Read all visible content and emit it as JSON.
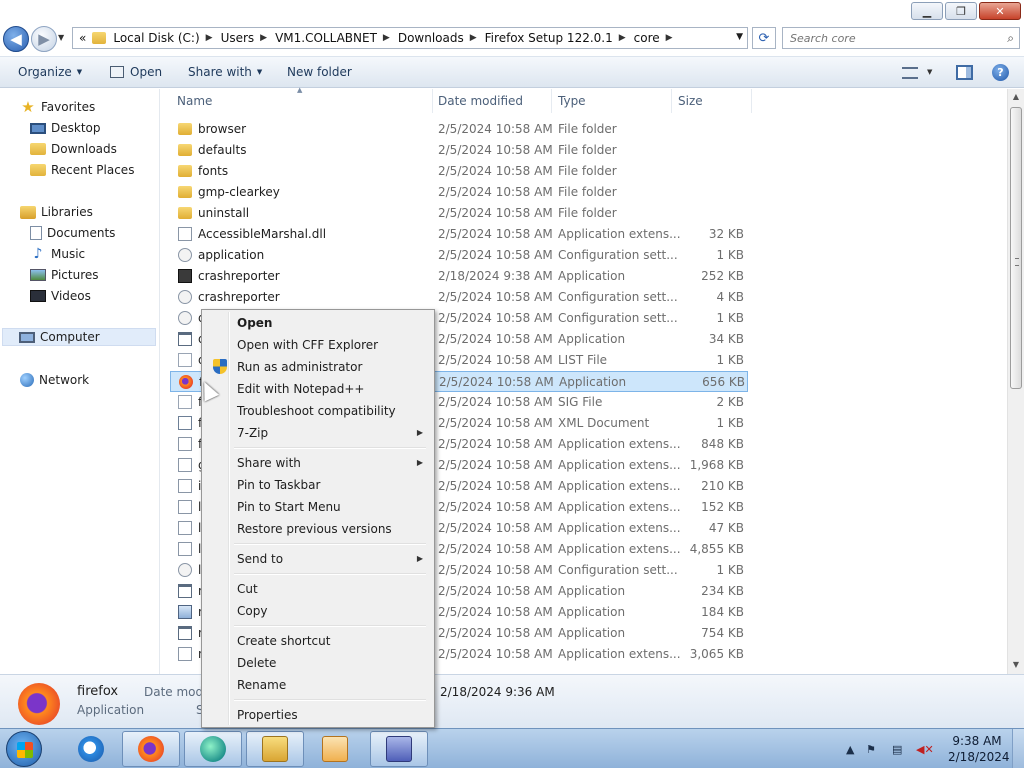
{
  "window": {
    "minimize_label": "▁",
    "maximize_label": "❐",
    "close_label": "✕"
  },
  "address": {
    "prefix": "«",
    "breadcrumbs": [
      "Local Disk (C:)",
      "Users",
      "VM1.COLLABNET",
      "Downloads",
      "Firefox Setup 122.0.1",
      "core"
    ],
    "separator": "▶",
    "search_placeholder": "Search core"
  },
  "toolbar": {
    "organize": "Organize",
    "open": "Open",
    "share_with": "Share with",
    "new_folder": "New folder"
  },
  "nav": {
    "favorites": "Favorites",
    "desktop": "Desktop",
    "downloads": "Downloads",
    "recent_places": "Recent Places",
    "libraries": "Libraries",
    "documents": "Documents",
    "music": "Music",
    "pictures": "Pictures",
    "videos": "Videos",
    "computer": "Computer",
    "network": "Network"
  },
  "columns": {
    "name": "Name",
    "date_modified": "Date modified",
    "type": "Type",
    "size": "Size"
  },
  "files": [
    {
      "name": "browser",
      "date": "2/5/2024 10:58 AM",
      "type": "File folder",
      "size": "",
      "icon": "folder"
    },
    {
      "name": "defaults",
      "date": "2/5/2024 10:58 AM",
      "type": "File folder",
      "size": "",
      "icon": "folder"
    },
    {
      "name": "fonts",
      "date": "2/5/2024 10:58 AM",
      "type": "File folder",
      "size": "",
      "icon": "folder"
    },
    {
      "name": "gmp-clearkey",
      "date": "2/5/2024 10:58 AM",
      "type": "File folder",
      "size": "",
      "icon": "folder"
    },
    {
      "name": "uninstall",
      "date": "2/5/2024 10:58 AM",
      "type": "File folder",
      "size": "",
      "icon": "folder"
    },
    {
      "name": "AccessibleMarshal.dll",
      "date": "2/5/2024 10:58 AM",
      "type": "Application extens...",
      "size": "32 KB",
      "icon": "dll"
    },
    {
      "name": "application",
      "date": "2/5/2024 10:58 AM",
      "type": "Configuration sett...",
      "size": "1 KB",
      "icon": "config"
    },
    {
      "name": "crashreporter",
      "date": "2/18/2024 9:38 AM",
      "type": "Application",
      "size": "252 KB",
      "icon": "crash"
    },
    {
      "name": "crashreporter",
      "date": "2/5/2024 10:58 AM",
      "type": "Configuration sett...",
      "size": "4 KB",
      "icon": "config"
    },
    {
      "name": "d",
      "date": "2/5/2024 10:58 AM",
      "type": "Configuration sett...",
      "size": "1 KB",
      "icon": "config"
    },
    {
      "name": "d",
      "date": "2/5/2024 10:58 AM",
      "type": "Application",
      "size": "34 KB",
      "icon": "app"
    },
    {
      "name": "d",
      "date": "2/5/2024 10:58 AM",
      "type": "LIST File",
      "size": "1 KB",
      "icon": "file"
    },
    {
      "name": "f",
      "date": "2/5/2024 10:58 AM",
      "type": "Application",
      "size": "656 KB",
      "icon": "ff"
    },
    {
      "name": "f",
      "date": "2/5/2024 10:58 AM",
      "type": "SIG File",
      "size": "2 KB",
      "icon": "file"
    },
    {
      "name": "f",
      "date": "2/5/2024 10:58 AM",
      "type": "XML Document",
      "size": "1 KB",
      "icon": "xml"
    },
    {
      "name": "f",
      "date": "2/5/2024 10:58 AM",
      "type": "Application extens...",
      "size": "848 KB",
      "icon": "dll"
    },
    {
      "name": "g",
      "date": "2/5/2024 10:58 AM",
      "type": "Application extens...",
      "size": "1,968 KB",
      "icon": "dll"
    },
    {
      "name": "i",
      "date": "2/5/2024 10:58 AM",
      "type": "Application extens...",
      "size": "210 KB",
      "icon": "dll"
    },
    {
      "name": "l",
      "date": "2/5/2024 10:58 AM",
      "type": "Application extens...",
      "size": "152 KB",
      "icon": "dll"
    },
    {
      "name": "l",
      "date": "2/5/2024 10:58 AM",
      "type": "Application extens...",
      "size": "47 KB",
      "icon": "dll"
    },
    {
      "name": "l",
      "date": "2/5/2024 10:58 AM",
      "type": "Application extens...",
      "size": "4,855 KB",
      "icon": "dll"
    },
    {
      "name": "l",
      "date": "2/5/2024 10:58 AM",
      "type": "Configuration sett...",
      "size": "1 KB",
      "icon": "config"
    },
    {
      "name": "n",
      "date": "2/5/2024 10:58 AM",
      "type": "Application",
      "size": "234 KB",
      "icon": "app"
    },
    {
      "name": "n",
      "date": "2/5/2024 10:58 AM",
      "type": "Application",
      "size": "184 KB",
      "icon": "maint"
    },
    {
      "name": "n",
      "date": "2/5/2024 10:58 AM",
      "type": "Application",
      "size": "754 KB",
      "icon": "app"
    },
    {
      "name": "n",
      "date": "2/5/2024 10:58 AM",
      "type": "Application extens...",
      "size": "3,065 KB",
      "icon": "dll"
    }
  ],
  "selected_index": 12,
  "details": {
    "name": "firefox",
    "type": "Application",
    "date_label": "Date modi",
    "size_label": "S",
    "date_value": "2/18/2024 9:36 AM"
  },
  "context_menu": {
    "items": [
      {
        "label": "Open",
        "bold": true
      },
      {
        "label": "Open with CFF Explorer"
      },
      {
        "label": "Run as administrator",
        "shield": true
      },
      {
        "label": "Edit with Notepad++"
      },
      {
        "label": "Troubleshoot compatibility"
      },
      {
        "label": "7-Zip",
        "submenu": true
      },
      {
        "sep": true
      },
      {
        "label": "Share with",
        "submenu": true
      },
      {
        "label": "Pin to Taskbar"
      },
      {
        "label": "Pin to Start Menu"
      },
      {
        "label": "Restore previous versions"
      },
      {
        "sep": true
      },
      {
        "label": "Send to",
        "submenu": true
      },
      {
        "sep": true
      },
      {
        "label": "Cut"
      },
      {
        "label": "Copy"
      },
      {
        "sep": true
      },
      {
        "label": "Create shortcut"
      },
      {
        "label": "Delete"
      },
      {
        "label": "Rename"
      },
      {
        "sep": true
      },
      {
        "label": "Properties"
      }
    ],
    "submenu_arrow": "▶"
  },
  "taskbar": {
    "time": "9:38 AM",
    "date": "2/18/2024"
  },
  "colors": {
    "accent": "#2a5fb0",
    "selection": "#cde6fb"
  }
}
